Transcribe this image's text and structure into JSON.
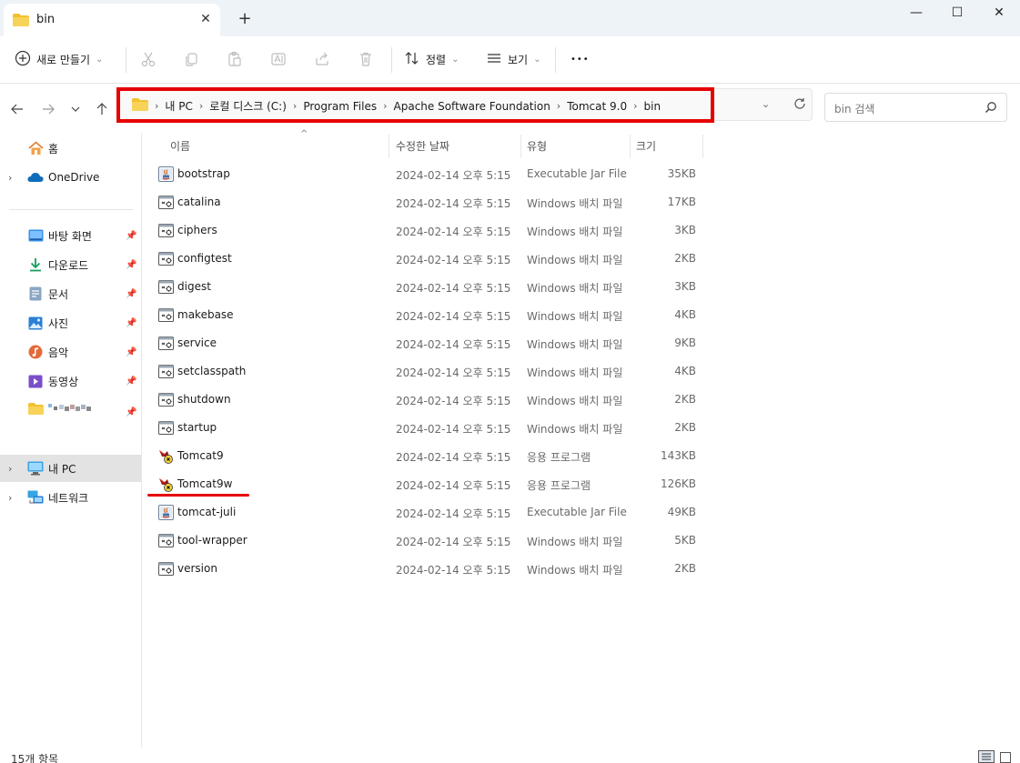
{
  "window": {
    "tab_title": "bin",
    "close_tab_glyph": "✕",
    "new_tab_glyph": "+",
    "minimize_glyph": "—",
    "maximize_glyph": "☐",
    "close_glyph": "✕"
  },
  "toolbar": {
    "new_label": "새로 만들기",
    "sort_label": "정렬",
    "view_label": "보기",
    "more_glyph": "•••",
    "icons": [
      "cut-icon",
      "copy-icon",
      "paste-icon",
      "rename-icon",
      "share-icon",
      "delete-icon"
    ]
  },
  "address": {
    "crumbs": [
      "내 PC",
      "로컬 디스크 (C:)",
      "Program Files",
      "Apache Software Foundation",
      "Tomcat 9.0",
      "bin"
    ],
    "search_placeholder": "bin 검색"
  },
  "sidebar": {
    "home": "홈",
    "onedrive": "OneDrive",
    "quick": [
      {
        "label": "바탕 화면",
        "icon": "desktop-icon"
      },
      {
        "label": "다운로드",
        "icon": "download-icon"
      },
      {
        "label": "문서",
        "icon": "document-icon"
      },
      {
        "label": "사진",
        "icon": "pictures-icon"
      },
      {
        "label": "음악",
        "icon": "music-icon"
      },
      {
        "label": "동영상",
        "icon": "video-icon"
      }
    ],
    "this_pc": "내 PC",
    "network": "네트워크"
  },
  "columns": {
    "name": "이름",
    "modified": "수정한 날짜",
    "type": "유형",
    "size": "크기"
  },
  "files": [
    {
      "name": "bootstrap",
      "date": "2024-02-14 오후 5:15",
      "type": "Executable Jar File",
      "size": "35KB",
      "icon": "jar"
    },
    {
      "name": "catalina",
      "date": "2024-02-14 오후 5:15",
      "type": "Windows 배치 파일",
      "size": "17KB",
      "icon": "bat"
    },
    {
      "name": "ciphers",
      "date": "2024-02-14 오후 5:15",
      "type": "Windows 배치 파일",
      "size": "3KB",
      "icon": "bat"
    },
    {
      "name": "configtest",
      "date": "2024-02-14 오후 5:15",
      "type": "Windows 배치 파일",
      "size": "2KB",
      "icon": "bat"
    },
    {
      "name": "digest",
      "date": "2024-02-14 오후 5:15",
      "type": "Windows 배치 파일",
      "size": "3KB",
      "icon": "bat"
    },
    {
      "name": "makebase",
      "date": "2024-02-14 오후 5:15",
      "type": "Windows 배치 파일",
      "size": "4KB",
      "icon": "bat"
    },
    {
      "name": "service",
      "date": "2024-02-14 오후 5:15",
      "type": "Windows 배치 파일",
      "size": "9KB",
      "icon": "bat"
    },
    {
      "name": "setclasspath",
      "date": "2024-02-14 오후 5:15",
      "type": "Windows 배치 파일",
      "size": "4KB",
      "icon": "bat"
    },
    {
      "name": "shutdown",
      "date": "2024-02-14 오후 5:15",
      "type": "Windows 배치 파일",
      "size": "2KB",
      "icon": "bat"
    },
    {
      "name": "startup",
      "date": "2024-02-14 오후 5:15",
      "type": "Windows 배치 파일",
      "size": "2KB",
      "icon": "bat"
    },
    {
      "name": "Tomcat9",
      "date": "2024-02-14 오후 5:15",
      "type": "응용 프로그램",
      "size": "143KB",
      "icon": "exe"
    },
    {
      "name": "Tomcat9w",
      "date": "2024-02-14 오후 5:15",
      "type": "응용 프로그램",
      "size": "126KB",
      "icon": "exe"
    },
    {
      "name": "tomcat-juli",
      "date": "2024-02-14 오후 5:15",
      "type": "Executable Jar File",
      "size": "49KB",
      "icon": "jar"
    },
    {
      "name": "tool-wrapper",
      "date": "2024-02-14 오후 5:15",
      "type": "Windows 배치 파일",
      "size": "5KB",
      "icon": "bat"
    },
    {
      "name": "version",
      "date": "2024-02-14 오후 5:15",
      "type": "Windows 배치 파일",
      "size": "2KB",
      "icon": "bat"
    }
  ],
  "status": {
    "count": "15개 항목"
  },
  "colors": {
    "highlight": "#e60000",
    "folder": "#f3c12f",
    "onedrive": "#0f6cbd"
  }
}
